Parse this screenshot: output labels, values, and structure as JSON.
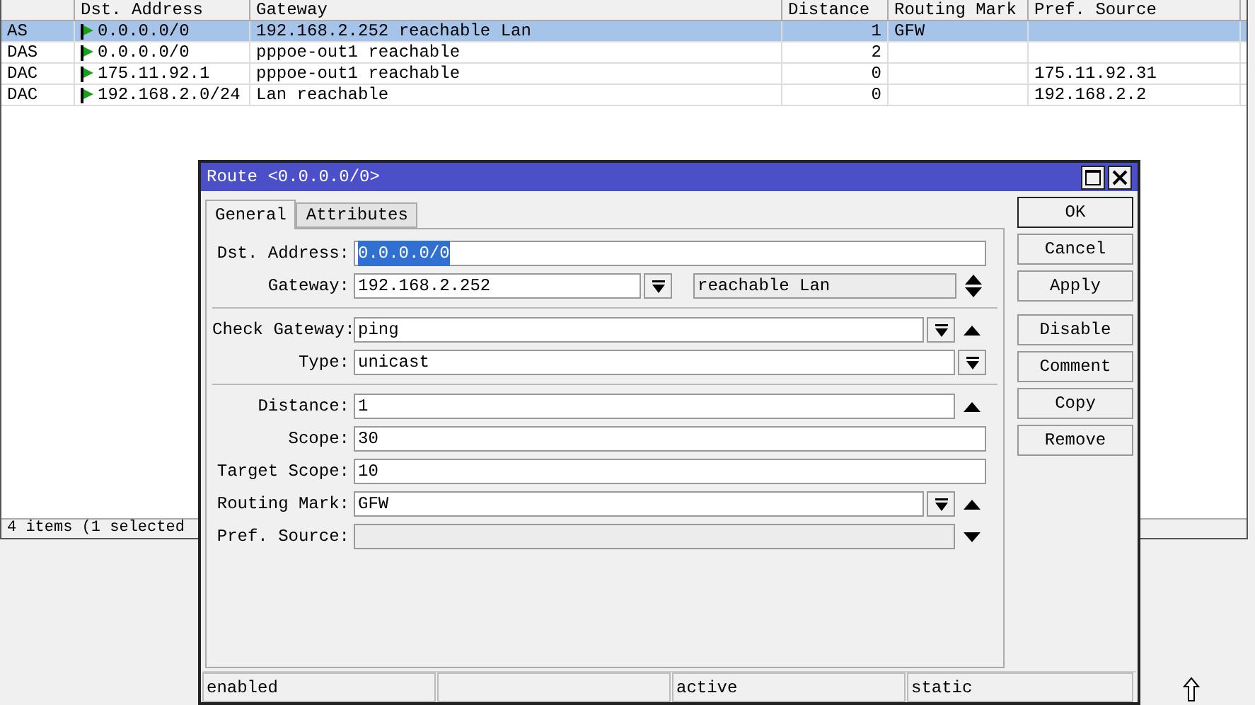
{
  "route_list": {
    "columns": [
      "Dst. Address",
      "Gateway",
      "Distance",
      "Routing Mark",
      "Pref. Source"
    ],
    "rows": [
      {
        "type": "AS",
        "dst": "0.0.0.0/0",
        "gateway": "192.168.2.252 reachable Lan",
        "distance": "1",
        "routing_mark": "GFW",
        "selected": true
      },
      {
        "type": "DAS",
        "dst": "0.0.0.0/0",
        "gateway": "pppoe-out1 reachable",
        "distance": "2",
        "selected": false
      },
      {
        "type": "DAC",
        "dst": "175.11.92.1",
        "gateway": "pppoe-out1 reachable",
        "distance": "0",
        "pref_source": "175.11.92.31",
        "selected": false
      },
      {
        "type": "DAC",
        "dst": "192.168.2.0/24",
        "gateway": "Lan reachable",
        "distance": "0",
        "pref_source": "192.168.2.2",
        "selected": false
      }
    ],
    "status": "4 items (1 selected"
  },
  "dialog": {
    "title": "Route <0.0.0.0/0>",
    "tabs": [
      {
        "label": "General",
        "selected": true
      },
      {
        "label": "Attributes",
        "selected": false
      }
    ],
    "field_groups": [
      [
        {
          "label": "Dst. Address:",
          "value": "0.0.0.0/0",
          "kind": "text",
          "value_selected": true
        },
        {
          "label": "Gateway:",
          "value": "192.168.2.252",
          "kind": "dropdown",
          "status": "reachable Lan",
          "expand_up": true,
          "expand_down": true
        }
      ],
      [
        {
          "label": "Check Gateway:",
          "value": "ping",
          "kind": "dropdown",
          "expand_up": true
        },
        {
          "label": "Type:",
          "value": "unicast",
          "kind": "dropdown"
        }
      ],
      [
        {
          "label": "Distance:",
          "value": "1",
          "kind": "text",
          "expand_up": true
        },
        {
          "label": "Scope:",
          "value": "30",
          "kind": "text"
        },
        {
          "label": "Target Scope:",
          "value": "10",
          "kind": "text"
        },
        {
          "label": "Routing Mark:",
          "value": "GFW",
          "kind": "dropdown",
          "expand_up": true
        },
        {
          "label": "Pref. Source:",
          "kind": "text",
          "disabled": true,
          "expand_down": true
        }
      ]
    ],
    "button_groups": [
      [
        "OK",
        "Cancel",
        "Apply"
      ],
      [
        "Disable",
        "Comment",
        "Copy",
        "Remove"
      ]
    ],
    "status_bar": {
      "cell_1": "enabled",
      "cell_3": "active",
      "cell_4": "static"
    }
  }
}
